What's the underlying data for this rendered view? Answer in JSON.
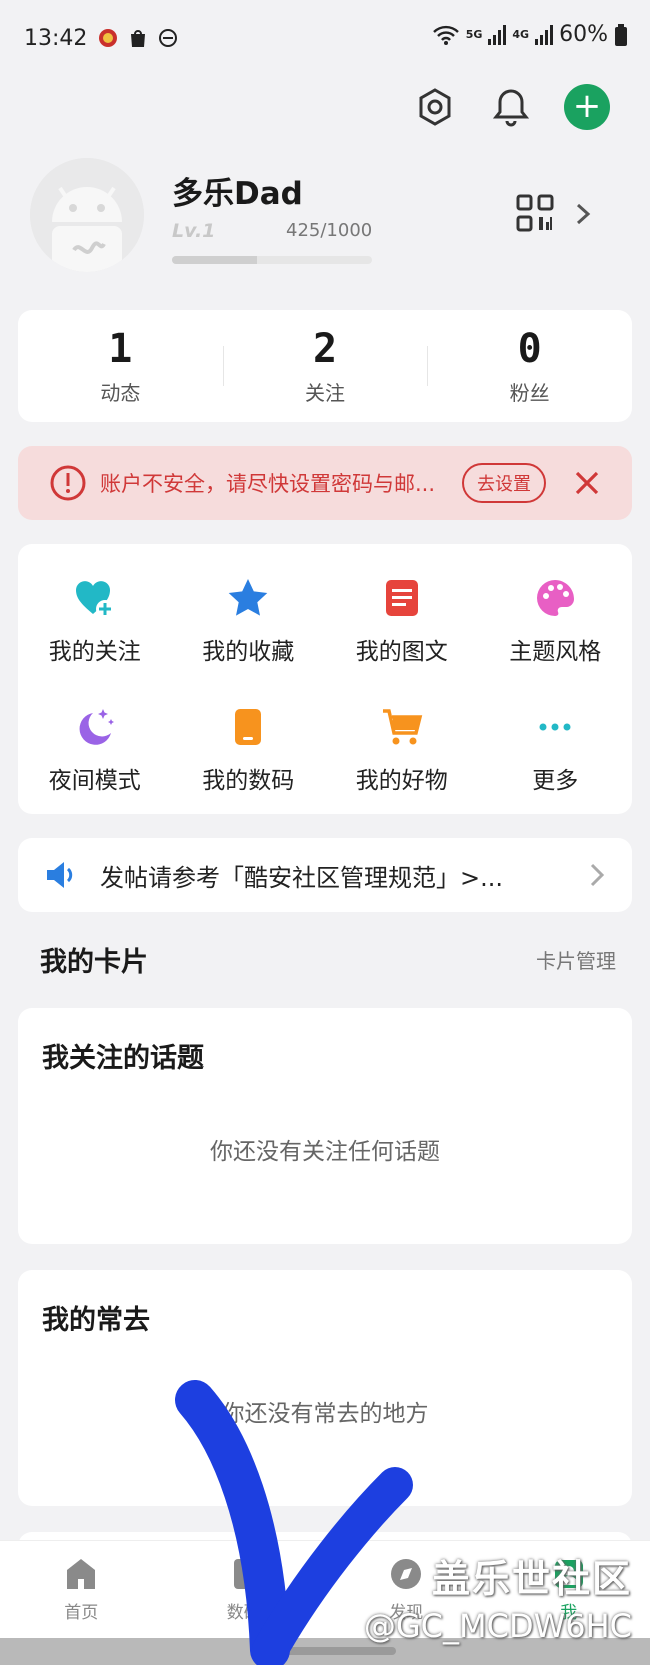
{
  "status_bar": {
    "time": "13:42",
    "battery": "60%",
    "net1": "5G",
    "net2": "4G"
  },
  "profile": {
    "username": "多乐Dad",
    "level": "Lv.1",
    "exp": "425/1000",
    "exp_progress": 0.425
  },
  "stats": [
    {
      "value": "1",
      "label": "动态"
    },
    {
      "value": "2",
      "label": "关注"
    },
    {
      "value": "0",
      "label": "粉丝"
    }
  ],
  "alert": {
    "text": "账户不安全，请尽快设置密码与邮...",
    "button": "去设置"
  },
  "grid": [
    {
      "label": "我的关注",
      "icon": "heart-plus-icon"
    },
    {
      "label": "我的收藏",
      "icon": "star-icon"
    },
    {
      "label": "我的图文",
      "icon": "document-icon"
    },
    {
      "label": "主题风格",
      "icon": "palette-icon"
    },
    {
      "label": "夜间模式",
      "icon": "moon-icon"
    },
    {
      "label": "我的数码",
      "icon": "phone-icon"
    },
    {
      "label": "我的好物",
      "icon": "cart-icon"
    },
    {
      "label": "更多",
      "icon": "more-icon"
    }
  ],
  "notice": {
    "text": "发帖请参考「酷安社区管理规范」>..."
  },
  "cards_section": {
    "title": "我的卡片",
    "manage": "卡片管理"
  },
  "topic_card": {
    "title": "我关注的话题",
    "empty": "你还没有关注任何话题"
  },
  "often_card": {
    "title": "我的常去",
    "empty": "你还没有常去的地方"
  },
  "tabs": [
    {
      "label": "首页",
      "icon": "home-icon"
    },
    {
      "label": "数码",
      "icon": "device-icon"
    },
    {
      "label": "发现",
      "icon": "compass-icon"
    },
    {
      "label": "我",
      "icon": "user-icon"
    }
  ],
  "watermark": {
    "line1": "盖乐世社区",
    "line2": "@GC_MCDW6HC"
  },
  "colors": {
    "accent": "#1aa260",
    "alert_text": "#d03838",
    "alert_bg": "#f6dcdc",
    "scribble": "#1d3fe0"
  }
}
